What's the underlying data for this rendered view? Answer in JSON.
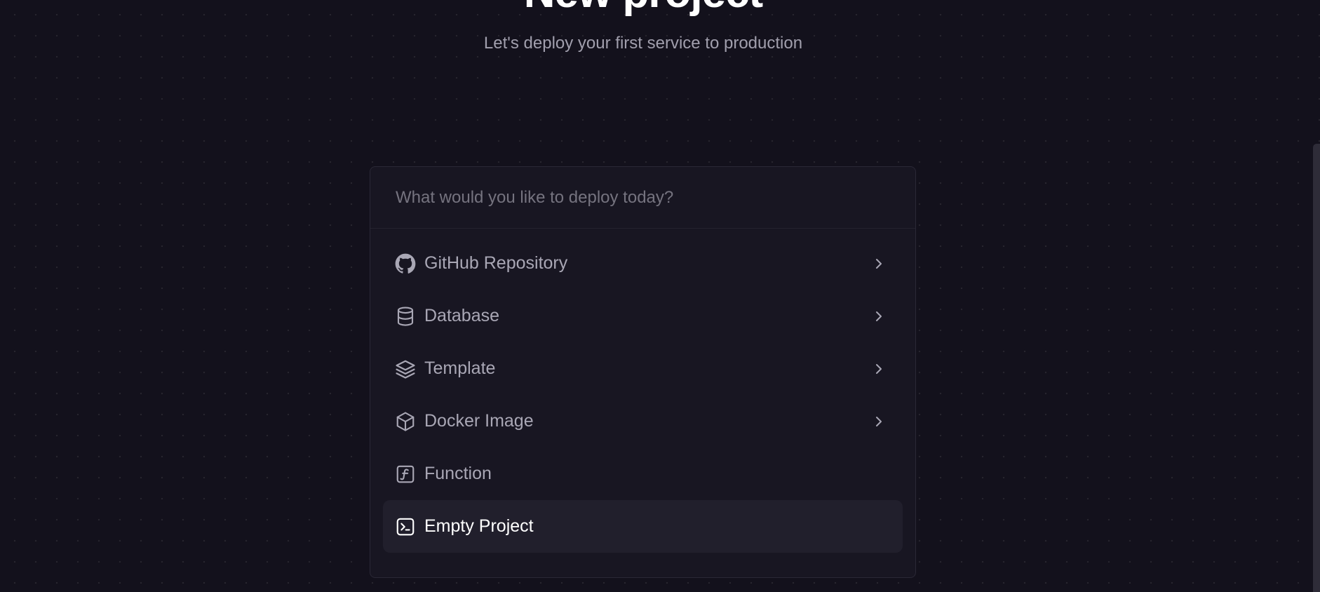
{
  "header": {
    "title": "New project",
    "subtitle": "Let's deploy your first service to production"
  },
  "search": {
    "placeholder": "What would you like to deploy today?",
    "value": ""
  },
  "options": [
    {
      "label": "GitHub Repository",
      "icon": "github-icon",
      "has_submenu": true,
      "selected": false
    },
    {
      "label": "Database",
      "icon": "database-icon",
      "has_submenu": true,
      "selected": false
    },
    {
      "label": "Template",
      "icon": "layers-icon",
      "has_submenu": true,
      "selected": false
    },
    {
      "label": "Docker Image",
      "icon": "cube-icon",
      "has_submenu": true,
      "selected": false
    },
    {
      "label": "Function",
      "icon": "function-icon",
      "has_submenu": false,
      "selected": false
    },
    {
      "label": "Empty Project",
      "icon": "terminal-icon",
      "has_submenu": false,
      "selected": true
    }
  ],
  "colors": {
    "background": "#13111c",
    "panel": "#181622",
    "selected_row": "#211f2c",
    "muted_text": "#a9a7b5",
    "subtitle_text": "#a19fad"
  }
}
